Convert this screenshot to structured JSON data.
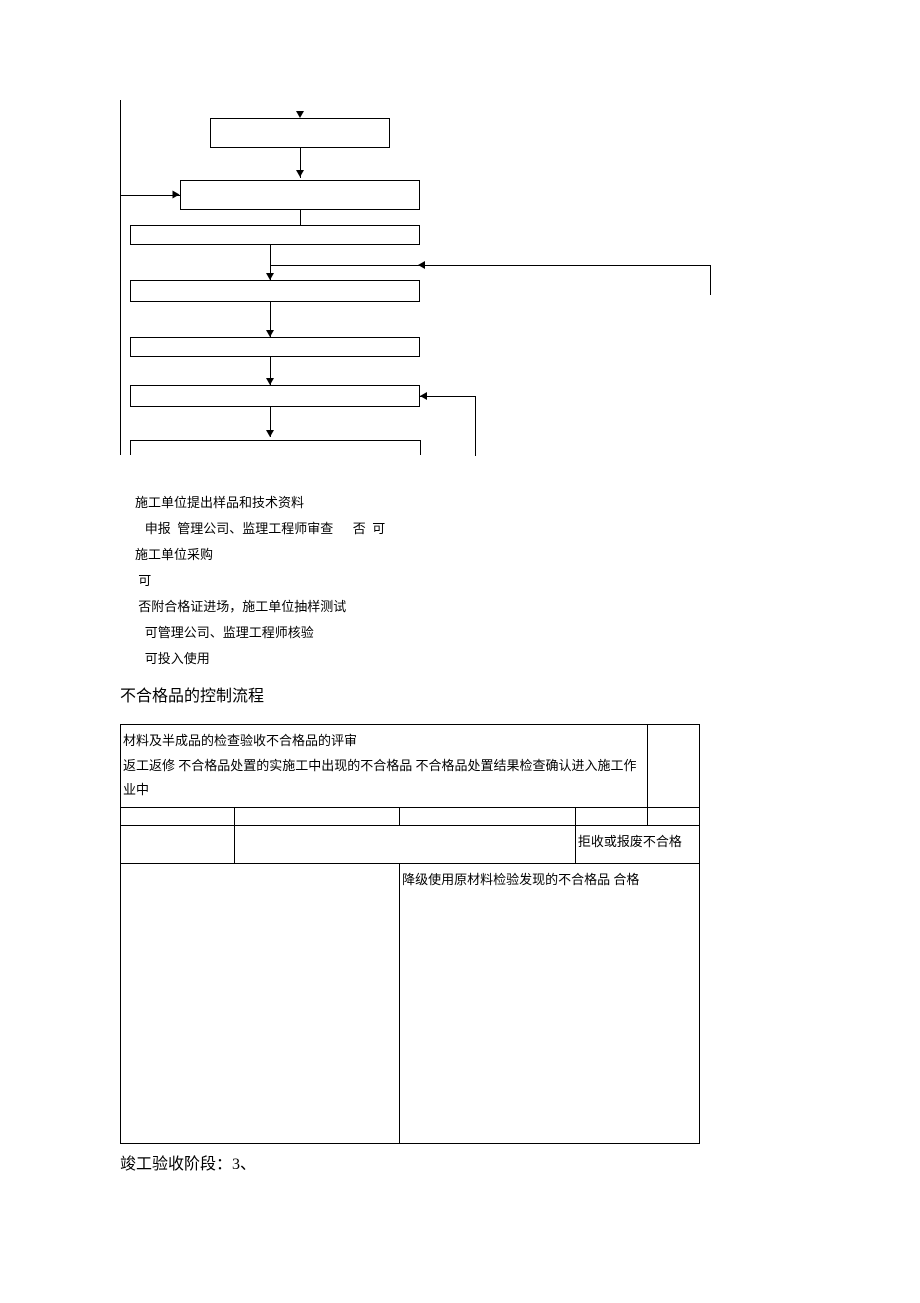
{
  "flowchart": {
    "boxes": [
      "",
      "",
      "",
      "",
      "",
      "",
      ""
    ]
  },
  "textblock": {
    "l1": "施工单位提出样品和技术资料",
    "l2": "   申报  管理公司、监理工程师审查      否  可",
    "l3": "施工单位采购",
    "l4": " 可",
    "l5": " 否附合格证进场，施工单位抽样测试",
    "l6": "   可管理公司、监理工程师核验",
    "l7": "   可投入使用"
  },
  "section_title_1": "不合格品的控制流程",
  "table": {
    "r1c1": "材料及半成品的检查验收不合格品的评审",
    "r1c2": "   返工返修  不合格品处置的实施工中出现的不合格品      不合格品处置结果检查确认进入施工作业中",
    "r2c4": " 拒收或报废不合格",
    "r3c3": "降级使用原材料检验发现的不合格品        合格"
  },
  "footer": "竣工验收阶段：3、"
}
